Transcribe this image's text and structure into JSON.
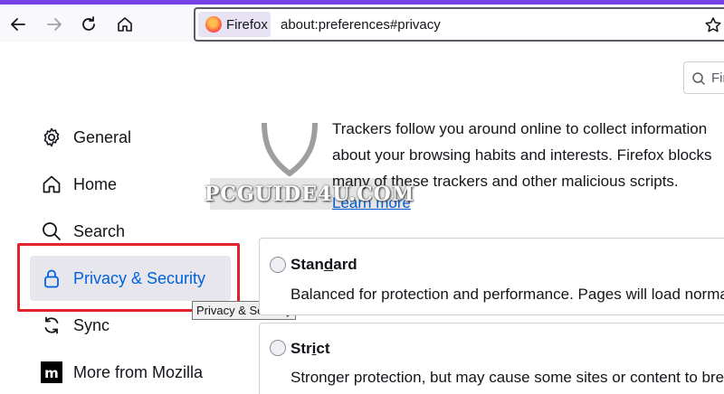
{
  "browser": {
    "identity_label": "Firefox",
    "url": "about:preferences#privacy",
    "accent_color": "#7542e5"
  },
  "search": {
    "placeholder_visible": "Fir"
  },
  "sidebar": {
    "items": [
      {
        "label": "General",
        "icon": "gear-icon"
      },
      {
        "label": "Home",
        "icon": "home-icon"
      },
      {
        "label": "Search",
        "icon": "search-icon"
      },
      {
        "label": "Privacy & Security",
        "icon": "lock-icon",
        "selected": true
      },
      {
        "label": "Sync",
        "icon": "sync-icon"
      },
      {
        "label": "More from Mozilla",
        "icon": "mozilla-icon"
      }
    ],
    "tooltip": "Privacy & Security",
    "highlight_color": "#e1242b"
  },
  "main": {
    "description": "Trackers follow you around online to collect information about your browsing habits and interests. Firefox blocks many of these trackers and other malicious scripts.",
    "learn_more": "Learn more",
    "watermark": "PCGUIDE4U.COM",
    "options": [
      {
        "title_pre": "Stan",
        "title_u": "d",
        "title_post": "ard",
        "description": "Balanced for protection and performance. Pages will load normally."
      },
      {
        "title_pre": "Str",
        "title_u": "i",
        "title_post": "ct",
        "description": "Stronger protection, but may cause some sites or content to break."
      }
    ]
  }
}
